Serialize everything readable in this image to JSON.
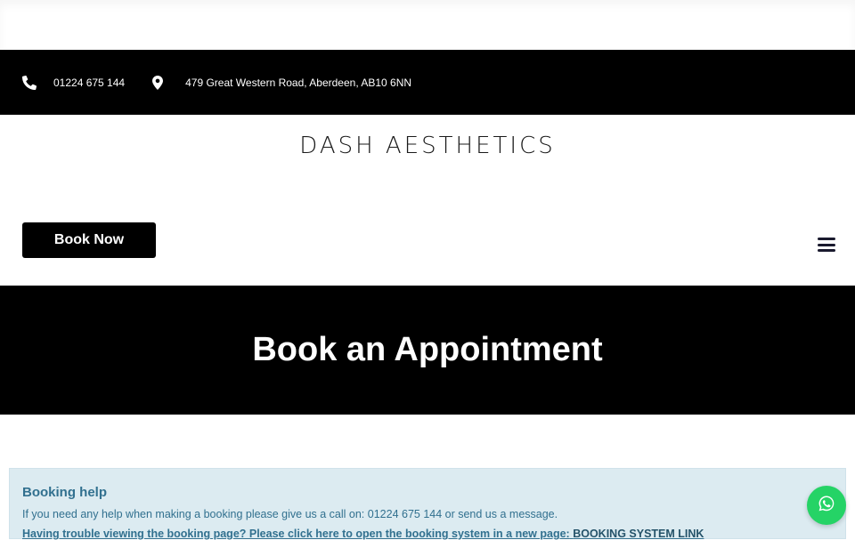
{
  "contact": {
    "phone": "01224 675 144",
    "address": "479 Great Western Road, Aberdeen, AB10 6NN"
  },
  "header": {
    "logo_text": "DASH AESTHETICS",
    "book_button_label": "Book Now"
  },
  "hero": {
    "title": "Book an Appointment"
  },
  "help": {
    "title": "Booking help",
    "text": "If you need any help when making a booking please give us a call on: 01224 675 144 or send us a message.",
    "link_text": "Having trouble viewing the booking page? Please click here to open the booking system in a new page:",
    "link_label": "BOOKING SYSTEM LINK"
  },
  "colors": {
    "bar_bg": "#000000",
    "help_bg": "#dcebf1",
    "help_text": "#31708f",
    "whatsapp": "#25d366"
  },
  "icons": {
    "phone": "phone-icon",
    "location": "map-marker-icon",
    "menu": "hamburger-menu-icon",
    "whatsapp": "whatsapp-icon"
  }
}
